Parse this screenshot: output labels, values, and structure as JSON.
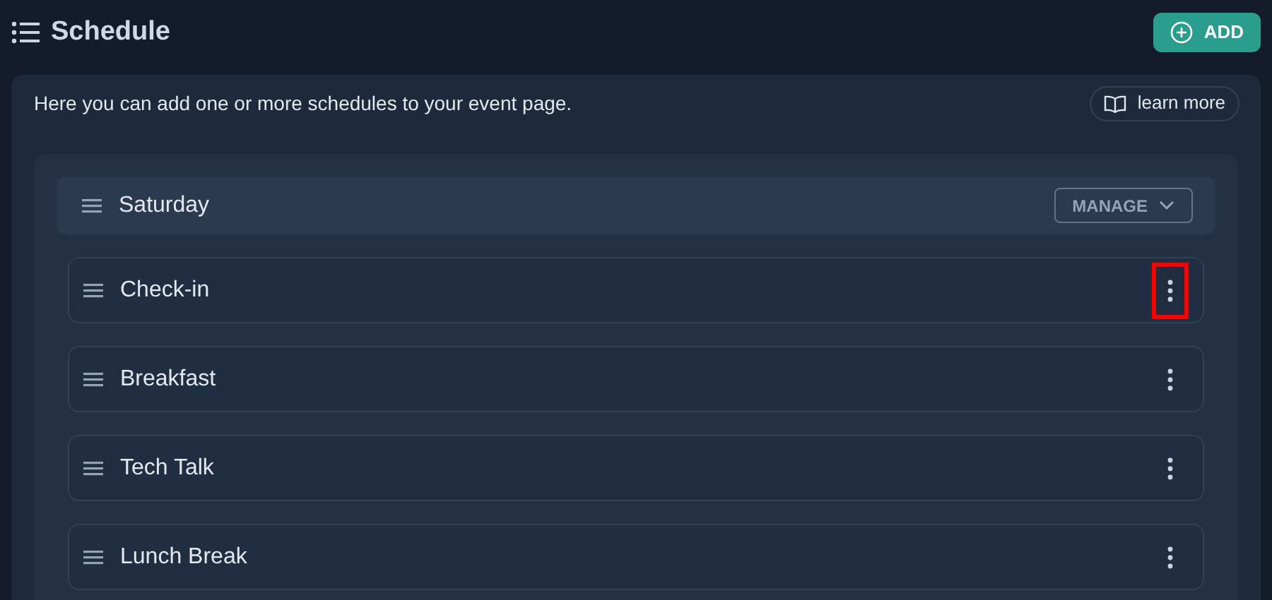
{
  "header": {
    "title": "Schedule",
    "add_button": "ADD"
  },
  "intro": {
    "text": "Here you can add one or more schedules to your event page.",
    "learn_more": "learn more"
  },
  "day": {
    "title": "Saturday",
    "manage_button": "MANAGE"
  },
  "items": [
    {
      "title": "Check-in",
      "highlighted": true
    },
    {
      "title": "Breakfast",
      "highlighted": false
    },
    {
      "title": "Tech Talk",
      "highlighted": false
    },
    {
      "title": "Lunch Break",
      "highlighted": false
    }
  ]
}
